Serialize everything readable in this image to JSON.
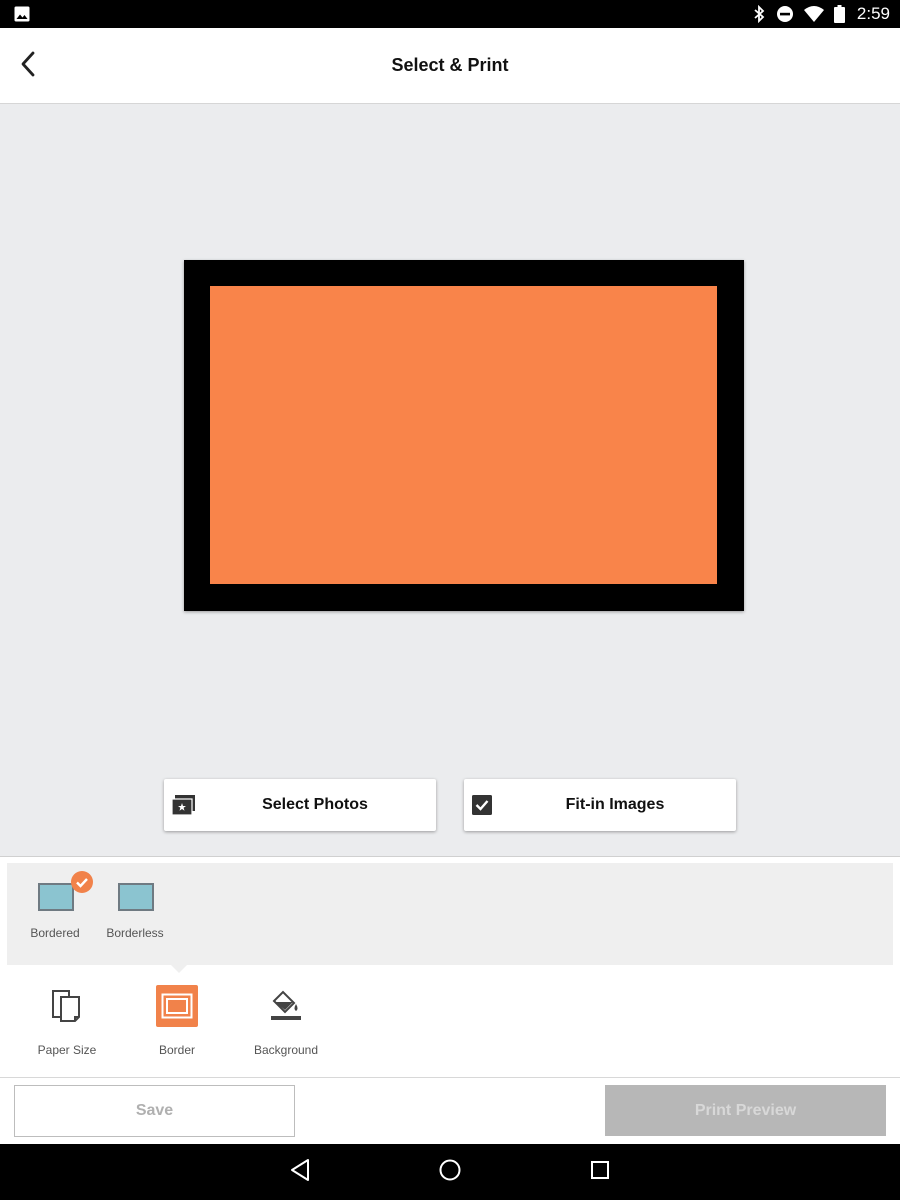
{
  "status_bar": {
    "time": "2:59",
    "icons": [
      "image-icon",
      "bluetooth-icon",
      "do-not-disturb-icon",
      "wifi-icon",
      "battery-icon"
    ]
  },
  "app_bar": {
    "title": "Select & Print",
    "back_icon": "chevron-left-icon"
  },
  "canvas": {
    "frame_color": "#000000",
    "photo_color": "#f9844a"
  },
  "actions": {
    "select_photos": {
      "label": "Select Photos",
      "icon": "photo-library-icon"
    },
    "fit_in_images": {
      "label": "Fit-in Images",
      "icon": "checkbox-checked-icon",
      "checked": true
    }
  },
  "border_options": [
    {
      "label": "Bordered",
      "selected": true
    },
    {
      "label": "Borderless",
      "selected": false
    }
  ],
  "tools": [
    {
      "label": "Paper Size",
      "icon": "paper-size-icon",
      "active": false
    },
    {
      "label": "Border",
      "icon": "border-frame-icon",
      "active": true
    },
    {
      "label": "Background",
      "icon": "paint-bucket-icon",
      "active": false
    }
  ],
  "bottom": {
    "save_label": "Save",
    "print_preview_label": "Print Preview"
  },
  "nav_bar": {
    "icons": [
      "nav-back-icon",
      "nav-home-icon",
      "nav-recents-icon"
    ]
  },
  "colors": {
    "accent": "#f1824a",
    "thumb_fill": "#8bc4d0",
    "disabled_button": "#b7b7b7"
  }
}
